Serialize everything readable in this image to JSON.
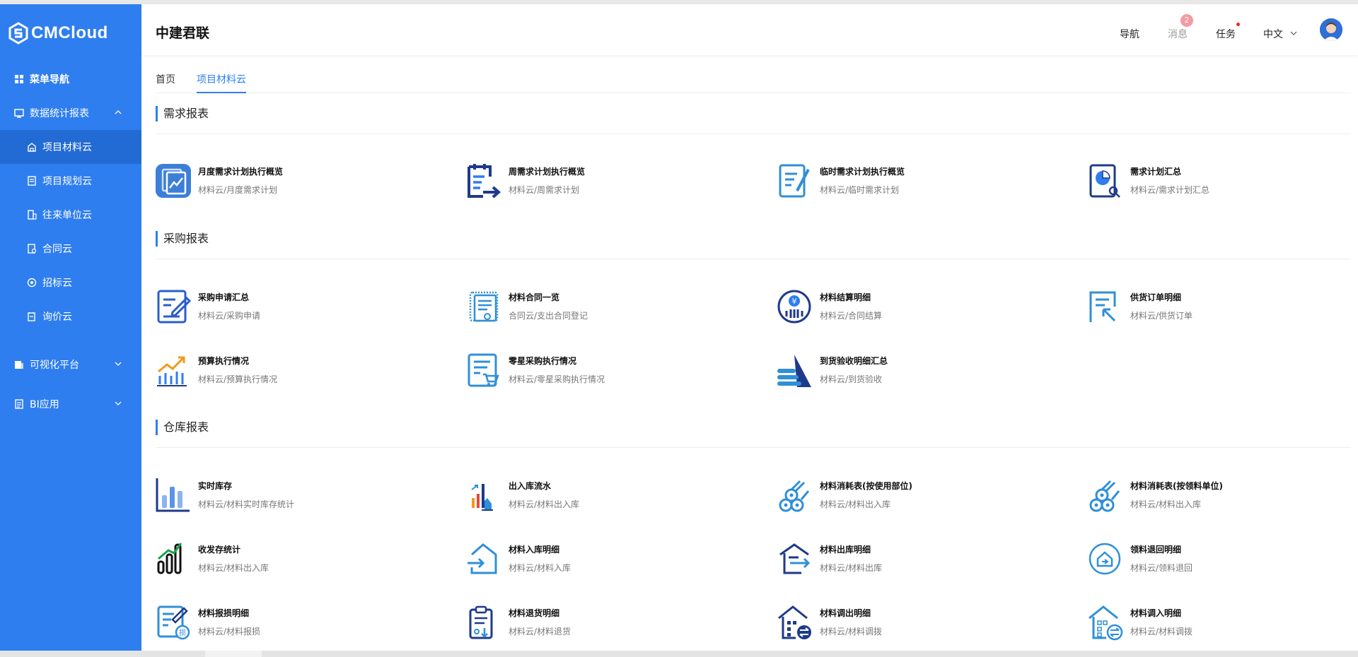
{
  "brand": {
    "logo_text": "CMCloud"
  },
  "colors": {
    "sidebar": "#2f7ef0",
    "sidebar_active": "#236bd4",
    "accent": "#2f7ef0",
    "badge": "#f59aa1"
  },
  "sidebar": {
    "items": [
      {
        "label": "菜单导航",
        "icon": "grid-icon"
      },
      {
        "label": "数据统计报表",
        "icon": "report-icon",
        "expanded": true
      },
      {
        "label": "项目材料云",
        "icon": "building-icon",
        "active": true
      },
      {
        "label": "项目规划云",
        "icon": "plan-icon"
      },
      {
        "label": "往来单位云",
        "icon": "company-icon"
      },
      {
        "label": "合同云",
        "icon": "contract-icon"
      },
      {
        "label": "招标云",
        "icon": "target-icon"
      },
      {
        "label": "询价云",
        "icon": "inquiry-icon"
      },
      {
        "label": "可视化平台",
        "icon": "visual-icon",
        "expanded": false
      },
      {
        "label": "BI应用",
        "icon": "bi-icon",
        "expanded": false
      }
    ]
  },
  "header": {
    "title": "中建君联",
    "nav": "导航",
    "messages": "消息",
    "messages_count": "2",
    "tasks": "任务",
    "language": "中文"
  },
  "tabs": [
    {
      "label": "首页"
    },
    {
      "label": "项目材料云",
      "active": true
    }
  ],
  "sections": [
    {
      "title": "需求报表",
      "cards": [
        {
          "title": "月度需求计划执行概览",
          "sub": "材料云/月度需求计划",
          "icon": "monthly-chart-icon"
        },
        {
          "title": "周需求计划执行概览",
          "sub": "材料云/周需求计划",
          "icon": "weekly-plan-icon"
        },
        {
          "title": "临时需求计划执行概览",
          "sub": "材料云/临时需求计划",
          "icon": "temp-plan-icon"
        },
        {
          "title": "需求计划汇总",
          "sub": "材料云/需求计划汇总",
          "icon": "pie-report-icon"
        }
      ]
    },
    {
      "title": "采购报表",
      "cards": [
        {
          "title": "采购申请汇总",
          "sub": "材料云/采购申请",
          "icon": "edit-form-icon"
        },
        {
          "title": "材料合同一览",
          "sub": "合同云/支出合同登记",
          "icon": "certificate-icon"
        },
        {
          "title": "材料结算明细",
          "sub": "材料云/合同结算",
          "icon": "yuan-coin-icon"
        },
        {
          "title": "供货订单明细",
          "sub": "材料云/供货订单",
          "icon": "order-icon"
        },
        {
          "title": "预算执行情况",
          "sub": "材料云/预算执行情况",
          "icon": "trend-chart-icon"
        },
        {
          "title": "零星采购执行情况",
          "sub": "材料云/零星采购执行情况",
          "icon": "cart-list-icon"
        },
        {
          "title": "到货验收明细汇总",
          "sub": "材料云/到货验收",
          "icon": "arrival-icon"
        }
      ]
    },
    {
      "title": "仓库报表",
      "cards": [
        {
          "title": "实时库存",
          "sub": "材料云/材料实时库存统计",
          "icon": "bar-stock-icon"
        },
        {
          "title": "出入库流水",
          "sub": "材料云/材料出入库",
          "icon": "flow-icon"
        },
        {
          "title": "材料消耗表(按使用部位)",
          "sub": "材料云/材料出入库",
          "icon": "pipes-icon"
        },
        {
          "title": "材料消耗表(按领料单位)",
          "sub": "材料云/材料出入库",
          "icon": "pipes-icon"
        },
        {
          "title": "收发存统计",
          "sub": "材料云/材料出入库",
          "icon": "growth-bars-icon"
        },
        {
          "title": "材料入库明细",
          "sub": "材料云/材料入库",
          "icon": "warehouse-in-icon"
        },
        {
          "title": "材料出库明细",
          "sub": "材料云/材料出库",
          "icon": "warehouse-out-icon"
        },
        {
          "title": "领料退回明细",
          "sub": "材料云/领料退回",
          "icon": "house-return-icon"
        },
        {
          "title": "材料报损明细",
          "sub": "材料云/材料报损",
          "icon": "loss-form-icon"
        },
        {
          "title": "材料退货明细",
          "sub": "材料云/材料退货",
          "icon": "return-doc-icon"
        },
        {
          "title": "材料调出明细",
          "sub": "材料云/材料调拨",
          "icon": "transfer-out-icon"
        },
        {
          "title": "材料调入明细",
          "sub": "材料云/材料调拨",
          "icon": "transfer-in-icon"
        }
      ]
    }
  ]
}
